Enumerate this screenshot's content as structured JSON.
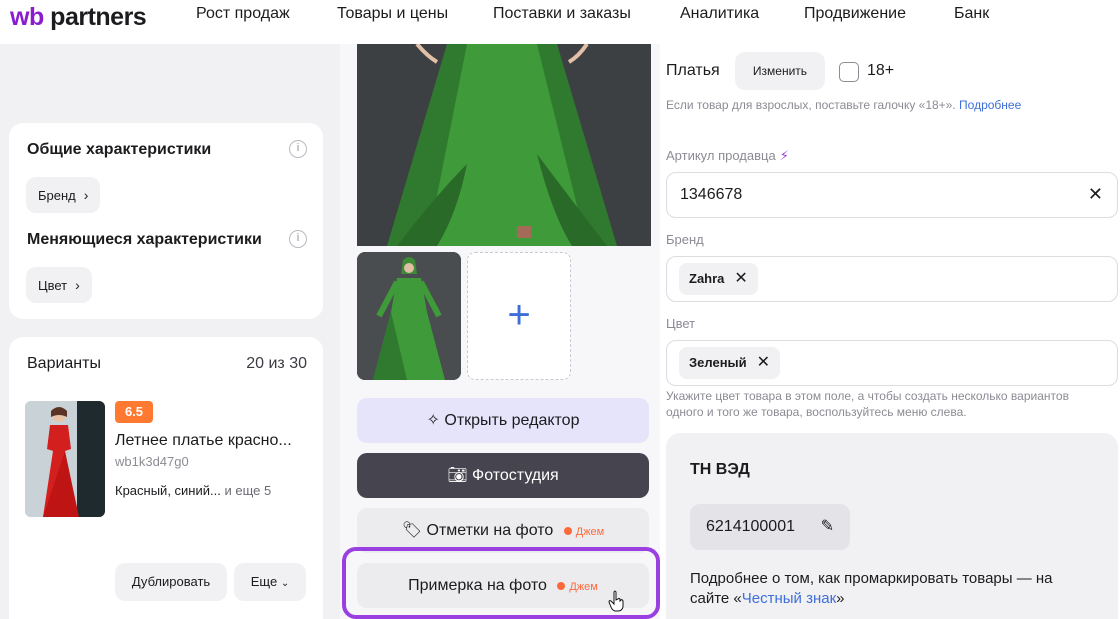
{
  "topnav": {
    "logo_wb": "wb",
    "logo_partners": "partners",
    "items": [
      {
        "label": "Рост продаж"
      },
      {
        "label": "Товары и цены"
      },
      {
        "label": "Поставки и заказы"
      },
      {
        "label": "Аналитика"
      },
      {
        "label": "Продвижение"
      },
      {
        "label": "Банк"
      }
    ]
  },
  "left": {
    "general": {
      "title": "Общие характеристики",
      "info_icon": "info-icon",
      "brand_chip": "Бренд"
    },
    "changing": {
      "title": "Меняющиеся характеристики",
      "info_icon": "info-icon",
      "color_chip": "Цвет"
    },
    "variants": {
      "title": "Варианты",
      "count": "20 из 30",
      "item": {
        "rating": "6.5",
        "name": "Летнее платье красно...",
        "sku": "wb1k3d47g0",
        "colors": "Красный, синий...",
        "more": "и еще 5"
      },
      "duplicate_button": "Дублировать",
      "more_button": "Еще"
    }
  },
  "middle": {
    "buttons": {
      "editor": "Открыть редактор",
      "studio": "Фотостудия",
      "marks": "Отметки на фото",
      "tryon": "Примерка на фото",
      "jam_badge": "Джем"
    }
  },
  "right": {
    "category": "Платья",
    "change_button": "Изменить",
    "adult_label": "18+",
    "adult_note": "Если товар для взрослых, поставьте галочку «18+».",
    "adult_link": "Подробнее",
    "seller_article": {
      "label": "Артикул продавца",
      "value": "1346678"
    },
    "brand": {
      "label": "Бренд",
      "tag": "Zahra"
    },
    "color": {
      "label": "Цвет",
      "tag": "Зеленый"
    },
    "color_note": "Укажите цвет товара в этом поле, а чтобы создать несколько вариантов одного и того же товара, воспользуйтесь меню слева.",
    "tnved": {
      "title": "ТН ВЭД",
      "code": "6214100001",
      "note_prefix": "Подробнее о том, как промаркировать товары — на сайте «",
      "note_link": "Честный знак",
      "note_suffix": "»"
    }
  },
  "colors": {
    "brand_purple": "#8a1ccf",
    "accent_blue": "#3e6fd8",
    "jam_orange": "#ff6a3d",
    "highlight": "#9a3fe0"
  }
}
